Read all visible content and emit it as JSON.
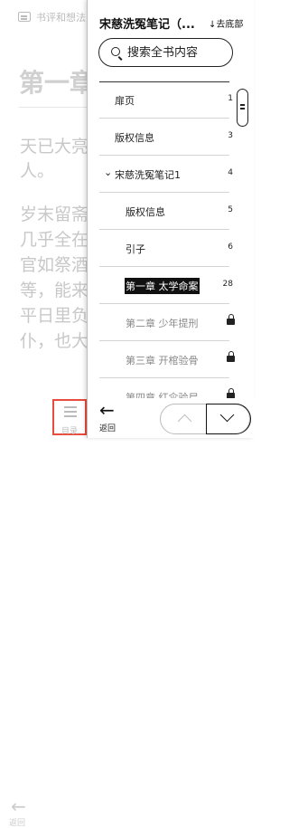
{
  "reader": {
    "top_label": "书评和想法",
    "chapter_title": "第一章",
    "paragraphs": [
      "天已大亮",
      "人。",
      "岁末留斋",
      "几乎全在",
      "官如祭酒",
      "等，能来",
      "平日里负",
      "仆，也大"
    ],
    "bottom": {
      "back_label": "返回",
      "toc_label": "目录"
    }
  },
  "panel": {
    "book_title": "宋慈洗冤笔记（...",
    "jump_bottom": "↓去底部",
    "search": {
      "placeholder": "搜索全书内容",
      "value": ""
    },
    "toc": [
      {
        "label": "扉页",
        "page": "1",
        "locked": false,
        "current": false,
        "level": 0
      },
      {
        "label": "版权信息",
        "page": "3",
        "locked": false,
        "current": false,
        "level": 0
      },
      {
        "label": "宋慈洗冤笔记1",
        "page": "4",
        "locked": false,
        "current": false,
        "level": 0,
        "expanded": true
      },
      {
        "label": "版权信息",
        "page": "5",
        "locked": false,
        "current": false,
        "level": 1
      },
      {
        "label": "引子",
        "page": "6",
        "locked": false,
        "current": false,
        "level": 1
      },
      {
        "label": "第一章 太学命案",
        "page": "28",
        "locked": false,
        "current": true,
        "level": 1
      },
      {
        "label": "第二章 少年提刑",
        "page": "",
        "locked": true,
        "current": false,
        "level": 1
      },
      {
        "label": "第三章 开棺验骨",
        "page": "",
        "locked": true,
        "current": false,
        "level": 1
      },
      {
        "label": "第四章 红伞验尸",
        "page": "",
        "locked": true,
        "current": false,
        "level": 1
      }
    ],
    "bottom": {
      "back_label": "返回"
    }
  },
  "icons": {
    "note": "note-icon",
    "search": "search-icon",
    "lock": "lock-icon",
    "back": "back-arrow-icon",
    "up": "chevron-up-icon",
    "down": "chevron-down-icon",
    "expand": "chevron-down-icon"
  },
  "colors": {
    "accent": "#e74c3c",
    "current_bg": "#111111",
    "locked_text": "#888888"
  }
}
